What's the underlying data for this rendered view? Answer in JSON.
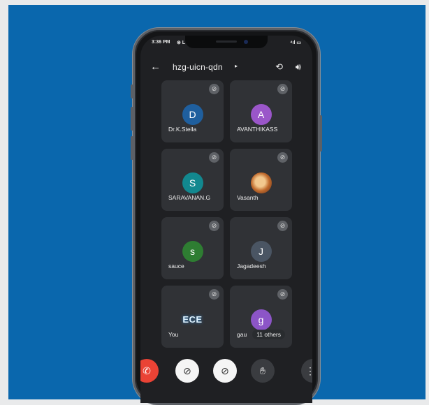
{
  "status_bar": {
    "time": "3:36 PM",
    "status_icons_text": "⊗ L",
    "signal_text": "⁴ıl ▭"
  },
  "call": {
    "meeting_code": "hzg-uicn-qdn"
  },
  "participants": [
    {
      "name": "Dr.K.Stella",
      "initial": "D",
      "avatar_color": "#1f5f9e",
      "muted": true
    },
    {
      "name": "AVANTHIKASS",
      "initial": "A",
      "avatar_color": "#9a56c9",
      "muted": true
    },
    {
      "name": "SARAVANAN.G",
      "initial": "S",
      "avatar_color": "#12888f",
      "muted": true
    },
    {
      "name": "Vasanth",
      "initial": "",
      "avatar_color": "",
      "muted": true
    },
    {
      "name": "sauce",
      "initial": "s",
      "avatar_color": "#2e7d32",
      "muted": true
    },
    {
      "name": "Jagadeesh",
      "initial": "J",
      "avatar_color": "#4a5563",
      "muted": true
    },
    {
      "name": "You",
      "initial": "ECE",
      "avatar_color": "",
      "muted": true
    },
    {
      "name": "gau",
      "initial": "g",
      "avatar_color": "#8c55c7",
      "muted": true
    }
  ],
  "others_chip": "11 others",
  "controls": {
    "end_call": "end-call-icon",
    "camera_off": "camera-off-icon",
    "mic_off": "mic-off-icon",
    "raise_hand": "hand-icon",
    "more": "more-vert-icon"
  }
}
